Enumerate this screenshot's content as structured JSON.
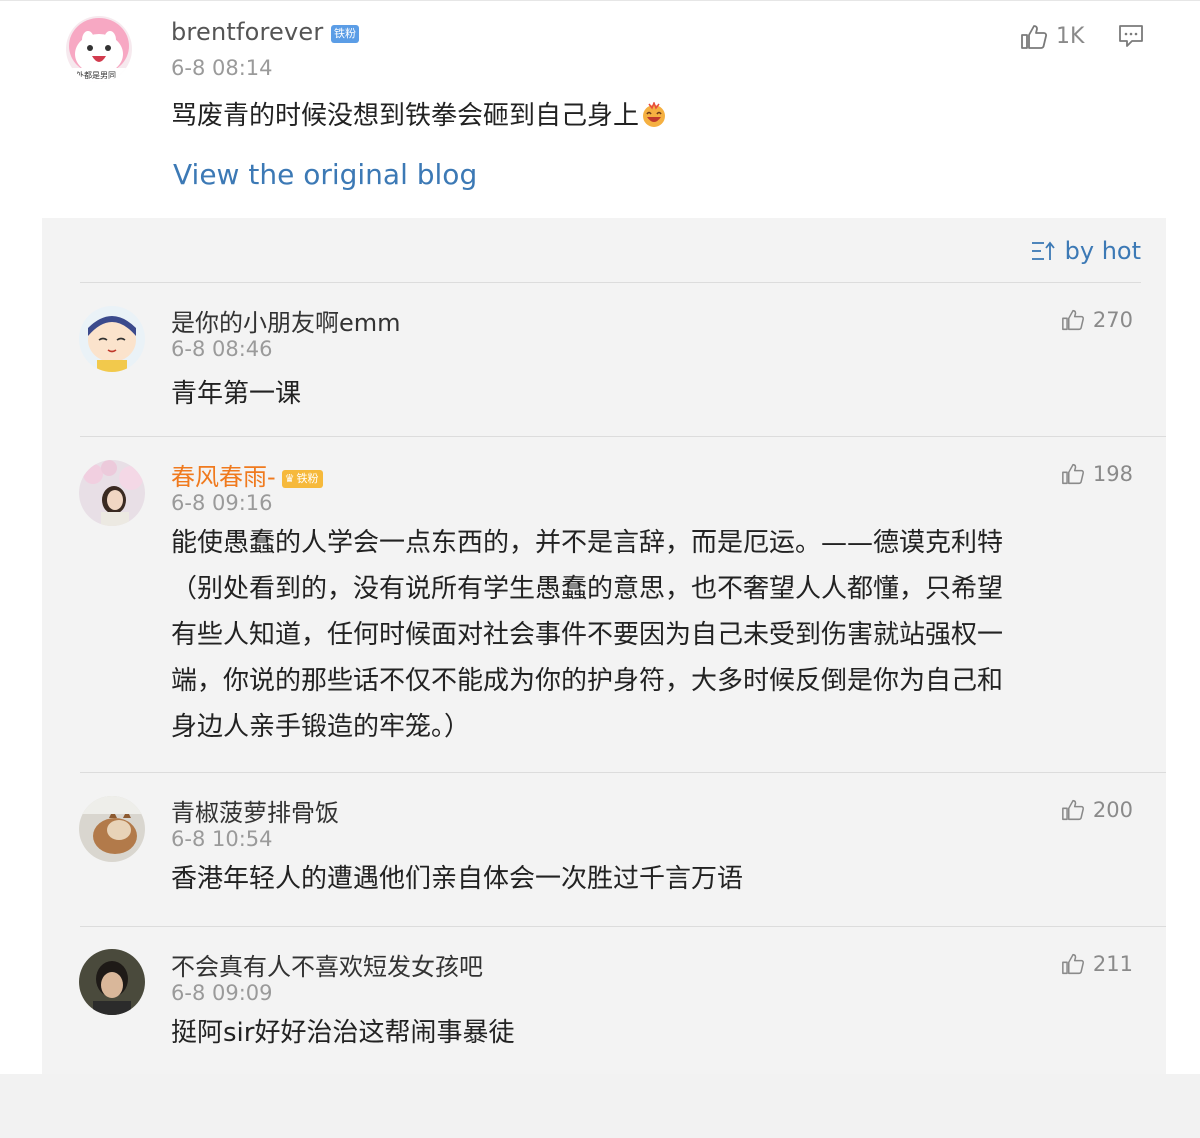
{
  "post": {
    "author": "brentforever",
    "badge": "铁粉",
    "avatar_text": "外都是男同",
    "time": "6-8 08:14",
    "likes": "1K",
    "text": "骂废青的时候没想到铁拳会砸到自己身上",
    "view_original": "View the original blog"
  },
  "sort": {
    "label": "by hot"
  },
  "comments": [
    {
      "author": "是你的小朋友啊emm",
      "time": "6-8 08:46",
      "likes": "270",
      "text": "青年第一课"
    },
    {
      "author": "春风春雨-",
      "badge": "铁粉",
      "time": "6-8 09:16",
      "likes": "198",
      "text_lines": [
        "能使愚蠢的人学会一点东西的，并不是言辞，而是厄运。——德谟克利特",
        "（别处看到的，没有说所有学生愚蠢的意思，也不奢望人人都懂，只希望",
        "有些人知道，任何时候面对社会事件不要因为自己未受到伤害就站强权一",
        "端，你说的那些话不仅不能成为你的护身符，大多时候反倒是你为自己和",
        "身边人亲手锻造的牢笼。）"
      ]
    },
    {
      "author": "青椒菠萝排骨饭",
      "time": "6-8 10:54",
      "likes": "200",
      "text": "香港年轻人的遭遇他们亲自体会一次胜过千言万语"
    },
    {
      "author": "不会真有人不喜欢短发女孩吧",
      "time": "6-8 09:09",
      "likes": "211",
      "text": "挺阿sir好好治治这帮闹事暴徒"
    }
  ],
  "icons": {
    "like": "thumbs-up-icon",
    "comment": "comment-icon",
    "sort": "sort-icon",
    "emoji": "laughing-emoji-icon"
  },
  "colors": {
    "link": "#3c79b5",
    "vip_name": "#f07a1e",
    "panel_bg": "#f3f3f3"
  }
}
